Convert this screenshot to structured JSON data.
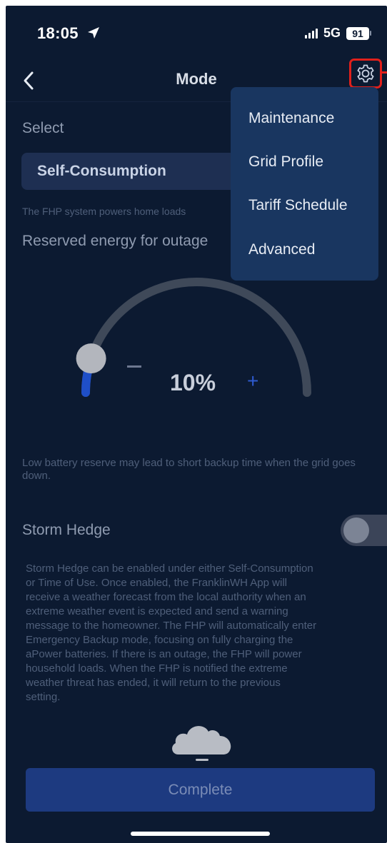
{
  "status_bar": {
    "time": "18:05",
    "network": "5G",
    "battery": "91"
  },
  "nav": {
    "title": "Mode"
  },
  "select": {
    "label": "Select",
    "value": "Self-Consumption",
    "description": "The FHP system powers home loads"
  },
  "reserve": {
    "label": "Reserved energy for outage",
    "value_text": "10%",
    "value_fraction": 0.1,
    "minus": "−",
    "plus": "+"
  },
  "menu": {
    "items": [
      "Maintenance",
      "Grid Profile",
      "Tariff Schedule",
      "Advanced"
    ]
  },
  "warning": "Low battery reserve may lead to short backup time when the grid goes down.",
  "storm_hedge": {
    "label": "Storm Hedge",
    "enabled": false,
    "lines": [
      "Storm Hedge can be enabled under either Self-Consumption",
      "or Time of Use. Once enabled, the FranklinWH App will",
      "receive a weather forecast from the local authority when an",
      "extreme weather event is expected and send a warning",
      "message to the homeowner. The FHP will automatically enter",
      "Emergency Backup mode, focusing on fully charging the",
      "aPower batteries. If there is an outage, the FHP will power",
      "household loads. When the FHP is notified the extreme",
      "weather threat has ended, it will return to the previous",
      "setting."
    ]
  },
  "complete_label": "Complete",
  "colors": {
    "background": "#0c1a31",
    "accent": "#2e5bd0",
    "highlight": "#e0201b"
  },
  "icons": {
    "back": "chevron-left-icon",
    "settings": "gear-icon",
    "location": "location-arrow-icon",
    "weather": "cloud-icon"
  }
}
